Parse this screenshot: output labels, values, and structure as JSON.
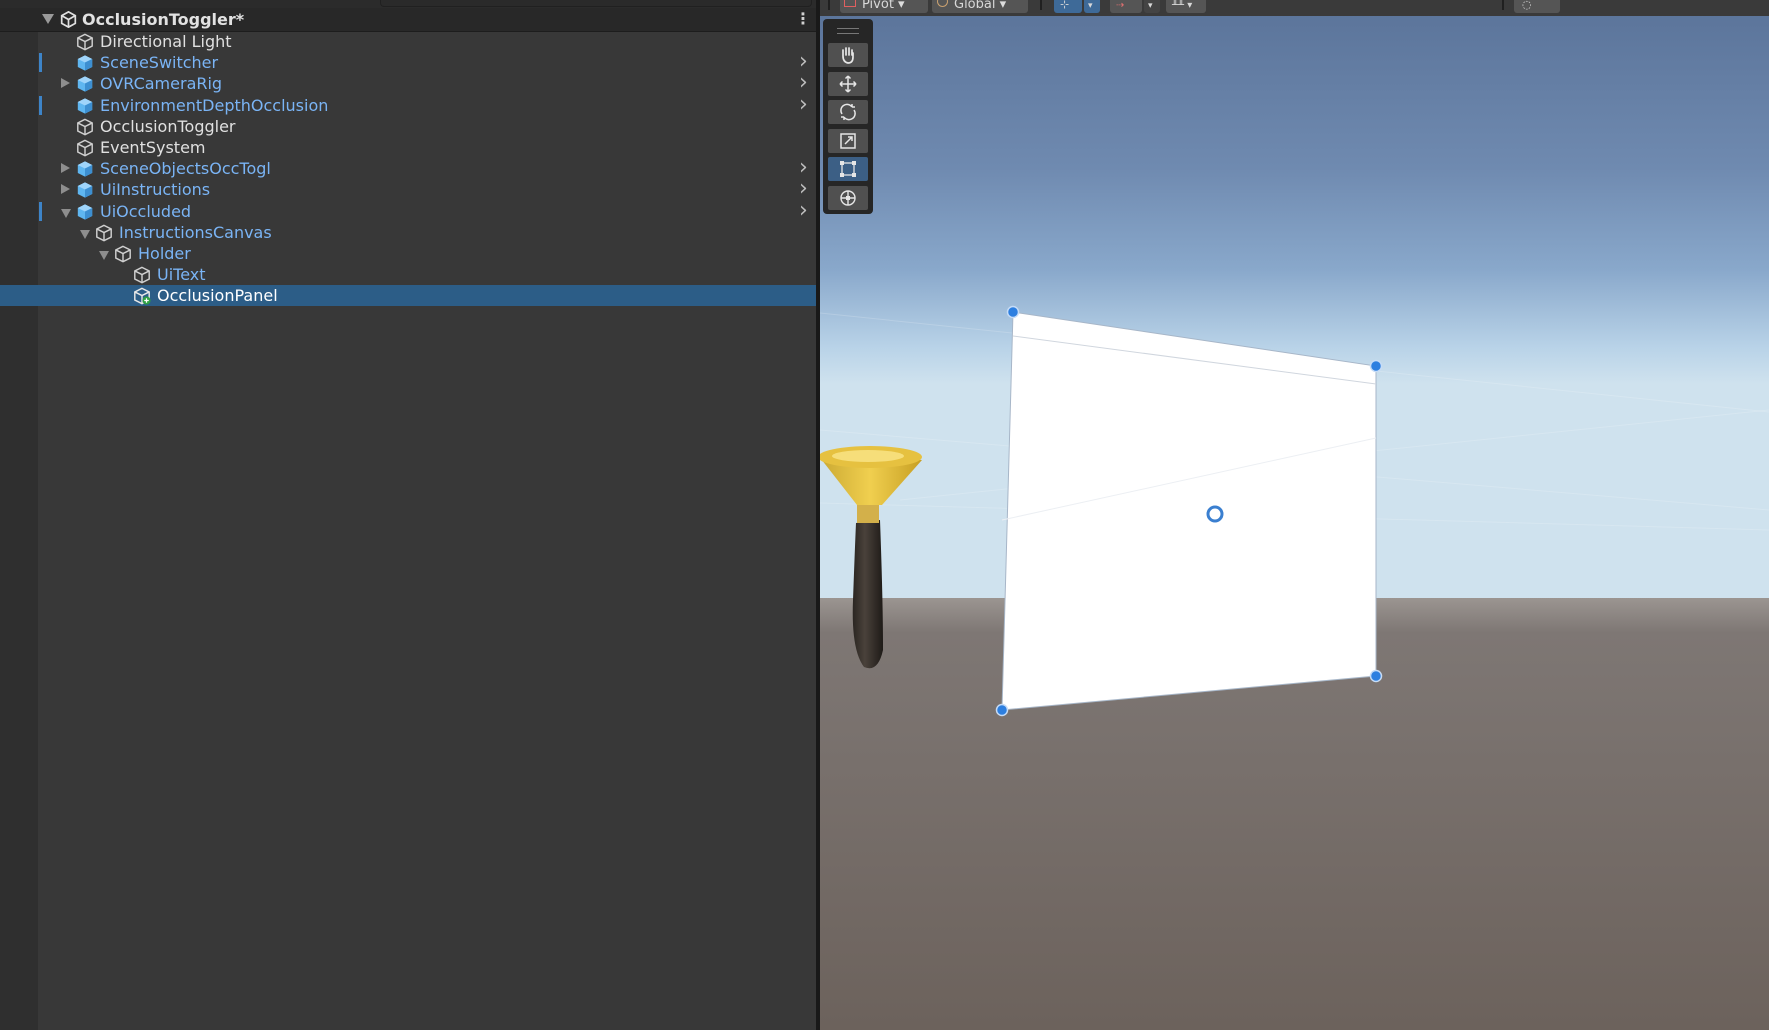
{
  "hierarchy": {
    "scene_title": "OcclusionToggler*",
    "items": [
      {
        "label": "Directional Light",
        "prefab": false,
        "indent": 0,
        "fold": "",
        "chevron": false,
        "modified": false,
        "selected": false
      },
      {
        "label": "SceneSwitcher",
        "prefab": true,
        "indent": 0,
        "fold": "",
        "chevron": true,
        "modified": true,
        "selected": false
      },
      {
        "label": "OVRCameraRig",
        "prefab": true,
        "indent": 0,
        "fold": "closed",
        "chevron": true,
        "modified": false,
        "selected": false
      },
      {
        "label": "EnvironmentDepthOcclusion",
        "prefab": true,
        "indent": 0,
        "fold": "",
        "chevron": true,
        "modified": true,
        "selected": false
      },
      {
        "label": "OcclusionToggler",
        "prefab": false,
        "indent": 0,
        "fold": "",
        "chevron": false,
        "modified": false,
        "selected": false
      },
      {
        "label": "EventSystem",
        "prefab": false,
        "indent": 0,
        "fold": "",
        "chevron": false,
        "modified": false,
        "selected": false
      },
      {
        "label": "SceneObjectsOccTogl",
        "prefab": true,
        "indent": 0,
        "fold": "closed",
        "chevron": true,
        "modified": false,
        "selected": false
      },
      {
        "label": "UiInstructions",
        "prefab": true,
        "indent": 0,
        "fold": "closed",
        "chevron": true,
        "modified": false,
        "selected": false
      },
      {
        "label": "UiOccluded",
        "prefab": true,
        "indent": 0,
        "fold": "open",
        "chevron": true,
        "modified": true,
        "selected": false
      },
      {
        "label": "InstructionsCanvas",
        "prefab": true,
        "indent": 1,
        "fold": "open",
        "chevron": false,
        "modified": false,
        "selected": false
      },
      {
        "label": "Holder",
        "prefab": true,
        "indent": 2,
        "fold": "open",
        "chevron": false,
        "modified": false,
        "selected": false
      },
      {
        "label": "UiText",
        "prefab": true,
        "indent": 3,
        "fold": "",
        "chevron": false,
        "modified": false,
        "selected": false
      },
      {
        "label": "OcclusionPanel",
        "prefab": false,
        "indent": 3,
        "fold": "",
        "chevron": false,
        "modified": false,
        "selected": true,
        "added": true
      }
    ]
  },
  "toolbar": {
    "pivot_label": "Pivot",
    "global_label": "Global"
  },
  "tools": [
    "hand-tool",
    "move-tool",
    "rotate-tool",
    "scale-tool",
    "rect-tool",
    "transform-tool"
  ],
  "active_tool": "rect-tool",
  "colors": {
    "selection": "#2c5d87",
    "prefab_text": "#7ab4f5",
    "prefab_icon": "#5fb6f0",
    "handle_blue": "#2d7fe0"
  }
}
